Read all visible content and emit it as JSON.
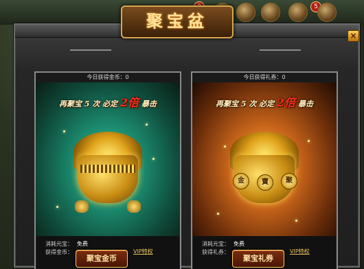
{
  "window": {
    "title": "聚宝盆",
    "close_label": "×"
  },
  "hud": {
    "badges": [
      "2",
      "5"
    ]
  },
  "panels": [
    {
      "header": "今日获得金币：0",
      "slogan_pre": "再聚宝 5 次 必定",
      "slogan_mult": "2倍",
      "slogan_post": "暴击",
      "cost_label": "消耗元宝：",
      "cost_value": "免费",
      "reward_label": "获得金币：",
      "reward_value": "25000",
      "vip_label": "VIP特权",
      "button_label": "聚宝金币",
      "theme": {
        "bg_top": "#1f5f5a",
        "bg_mid": "#1b8a6e",
        "bg_bottom": "#0e2d1f"
      }
    },
    {
      "header": "今日获得礼券：0",
      "slogan_pre": "再聚宝 5 次 必定",
      "slogan_mult": "2倍",
      "slogan_post": "暴击",
      "cost_label": "消耗元宝：",
      "cost_value": "免费",
      "reward_label": "获得礼券：",
      "reward_value": "150",
      "vip_label": "VIP特权",
      "button_label": "聚宝礼券",
      "pot_seals": [
        "金",
        "寶",
        "聚"
      ],
      "theme": {
        "bg_top": "#6a2d0a",
        "bg_mid": "#c7641a",
        "bg_bottom": "#2d1204"
      }
    }
  ]
}
